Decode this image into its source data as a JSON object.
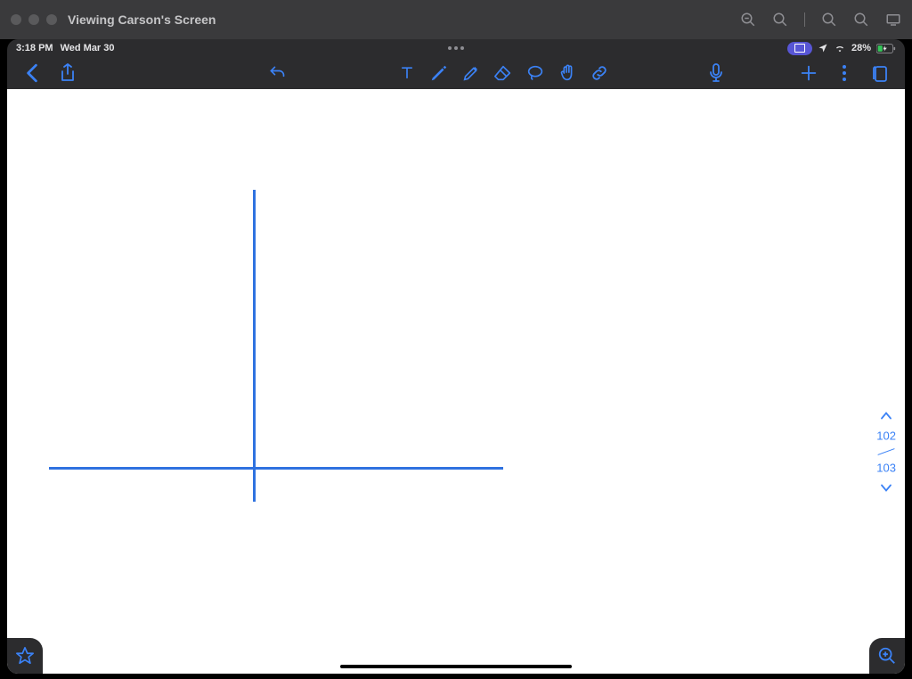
{
  "mac": {
    "window_title": "Viewing Carson's Screen"
  },
  "ipad": {
    "statusbar": {
      "time": "3:18 PM",
      "date": "Wed Mar 30",
      "battery_percent": "28%"
    },
    "toolbar": {
      "icons": {
        "back": "back",
        "share": "share",
        "undo": "undo",
        "text": "text-tool",
        "pen": "pen-tool",
        "highlighter": "highlighter-tool",
        "eraser": "eraser-tool",
        "lasso": "lasso-tool",
        "hand": "hand-tool",
        "link": "link-tool",
        "mic": "microphone",
        "add": "add",
        "more": "more",
        "pages": "pages-view"
      }
    },
    "page_nav": {
      "current": "102",
      "total": "103"
    },
    "canvas": {
      "strokes": [
        {
          "type": "vertical-line",
          "color": "#2f72e0"
        },
        {
          "type": "horizontal-line",
          "color": "#2f72e0"
        }
      ]
    }
  }
}
